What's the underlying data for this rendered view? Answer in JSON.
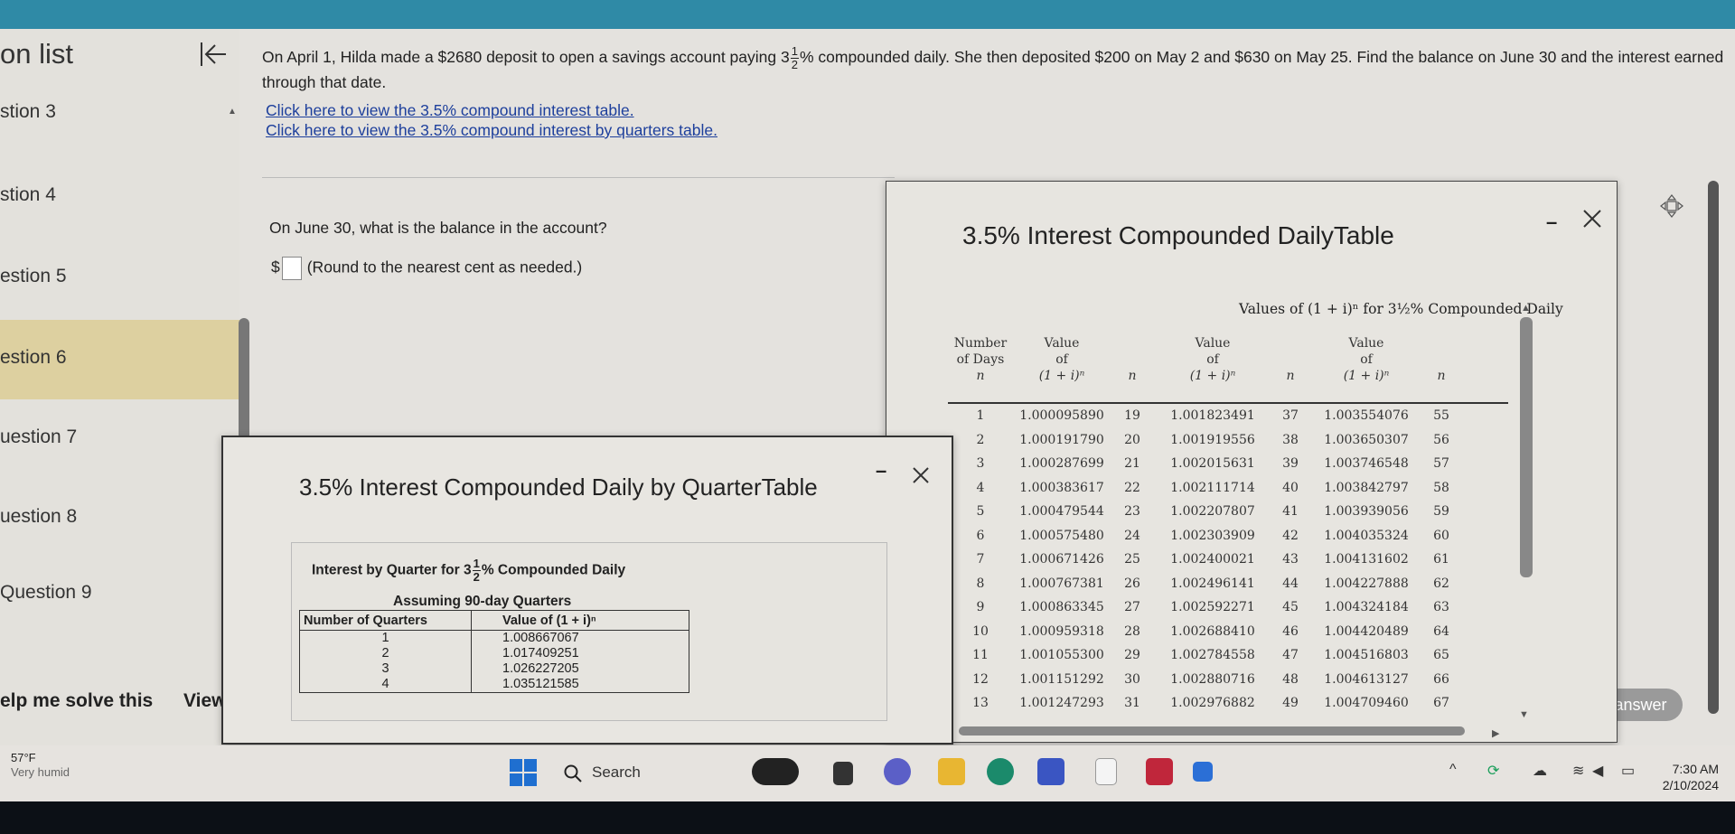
{
  "sidebar": {
    "title": "on list",
    "items": [
      {
        "label": "stion 3"
      },
      {
        "label": "stion 4"
      },
      {
        "label": "estion 5"
      },
      {
        "label": "estion 6"
      },
      {
        "label": "uestion 7"
      },
      {
        "label": "uestion 8"
      },
      {
        "label": "Question 9"
      }
    ],
    "help_label": "elp me solve this",
    "view_label": "View"
  },
  "question": {
    "text_part1": "On April 1, Hilda made a $2680 deposit to open a savings account paying 3",
    "frac_num": "1",
    "frac_den": "2",
    "text_part2": "% compounded daily. She then deposited $200 on May 2 and $630 on May 25. Find the balance on June 30 and the interest earned through that date.",
    "link1": "Click here to view the 3.5% compound interest table.",
    "link2": "Click here to view the 3.5% compound interest by quarters table.",
    "sub_question": "On June 30, what is the balance in the account?",
    "answer_prefix": "$",
    "answer_hint": "(Round to the nearest cent as needed.)",
    "check_answer": "ck answer"
  },
  "daily_dialog": {
    "title": "3.5% Interest Compounded DailyTable",
    "caption": "Values of (1 + i)ⁿ for 3½% Compounded Daily",
    "headers": [
      {
        "l1": "Number",
        "l2": "of Days",
        "l3": "n"
      },
      {
        "l1": "Value",
        "l2": "of",
        "l3": "(1 + i)ⁿ"
      },
      {
        "l1": "",
        "l2": "",
        "l3": "n"
      },
      {
        "l1": "Value",
        "l2": "of",
        "l3": "(1 + i)ⁿ"
      },
      {
        "l1": "",
        "l2": "",
        "l3": "n"
      },
      {
        "l1": "Value",
        "l2": "of",
        "l3": "(1 + i)ⁿ"
      },
      {
        "l1": "",
        "l2": "",
        "l3": "n"
      }
    ],
    "rows": [
      [
        "1",
        "1.000095890",
        "19",
        "1.001823491",
        "37",
        "1.003554076",
        "55"
      ],
      [
        "2",
        "1.000191790",
        "20",
        "1.001919556",
        "38",
        "1.003650307",
        "56"
      ],
      [
        "3",
        "1.000287699",
        "21",
        "1.002015631",
        "39",
        "1.003746548",
        "57"
      ],
      [
        "4",
        "1.000383617",
        "22",
        "1.002111714",
        "40",
        "1.003842797",
        "58"
      ],
      [
        "5",
        "1.000479544",
        "23",
        "1.002207807",
        "41",
        "1.003939056",
        "59"
      ],
      [
        "6",
        "1.000575480",
        "24",
        "1.002303909",
        "42",
        "1.004035324",
        "60"
      ],
      [
        "7",
        "1.000671426",
        "25",
        "1.002400021",
        "43",
        "1.004131602",
        "61"
      ],
      [
        "8",
        "1.000767381",
        "26",
        "1.002496141",
        "44",
        "1.004227888",
        "62"
      ],
      [
        "9",
        "1.000863345",
        "27",
        "1.002592271",
        "45",
        "1.004324184",
        "63"
      ],
      [
        "10",
        "1.000959318",
        "28",
        "1.002688410",
        "46",
        "1.004420489",
        "64"
      ],
      [
        "11",
        "1.001055300",
        "29",
        "1.002784558",
        "47",
        "1.004516803",
        "65"
      ],
      [
        "12",
        "1.001151292",
        "30",
        "1.002880716",
        "48",
        "1.004613127",
        "66"
      ],
      [
        "13",
        "1.001247293",
        "31",
        "1.002976882",
        "49",
        "1.004709460",
        "67"
      ]
    ]
  },
  "quarter_dialog": {
    "title": "3.5% Interest Compounded Daily by QuarterTable",
    "caption_part1": "Interest by Quarter for 3",
    "caption_num": "1",
    "caption_den": "2",
    "caption_part2": "% Compounded Daily",
    "caption_line2": "Assuming 90-day Quarters",
    "col1": "Number of Quarters",
    "col2": "Value of (1 + i)ⁿ",
    "rows": [
      [
        "1",
        "1.008667067"
      ],
      [
        "2",
        "1.017409251"
      ],
      [
        "3",
        "1.026227205"
      ],
      [
        "4",
        "1.035121585"
      ]
    ]
  },
  "taskbar": {
    "temp": "57°F",
    "weather": "Very humid",
    "search": "Search",
    "time": "7:30 AM",
    "date": "2/10/2024"
  }
}
